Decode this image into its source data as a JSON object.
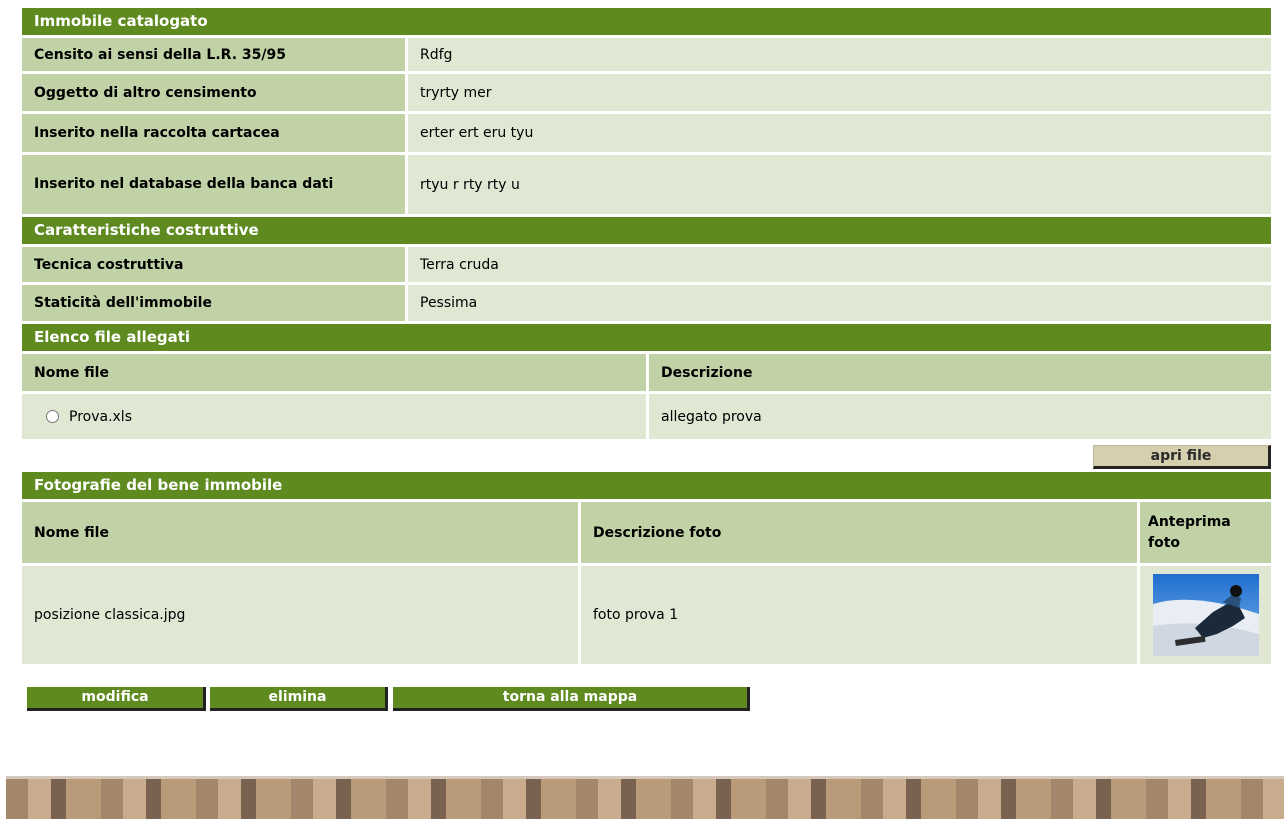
{
  "catalogato": {
    "header": "Immobile catalogato",
    "rows": [
      {
        "label": "Censito ai sensi della L.R. 35/95",
        "value": "Rdfg"
      },
      {
        "label": "Oggetto di altro censimento",
        "value": "tryrty mer"
      },
      {
        "label": "Inserito nella raccolta cartacea",
        "value": "erter ert eru tyu"
      },
      {
        "label": "Inserito nel database della banca dati",
        "value": "rtyu r rty rty u"
      }
    ]
  },
  "costruttive": {
    "header": "Caratteristiche costruttive",
    "rows": [
      {
        "label": "Tecnica costruttiva",
        "value": "Terra cruda"
      },
      {
        "label": "Staticità dell'immobile",
        "value": "Pessima"
      }
    ]
  },
  "allegati": {
    "header": "Elenco file allegati",
    "col_nome": "Nome file",
    "col_descrizione": "Descrizione",
    "file_name": "Prova.xls",
    "file_desc": "allegato prova",
    "open_button": "apri file"
  },
  "foto": {
    "header": "Fotografie del bene immobile",
    "col_nome": "Nome file",
    "col_descrizione": "Descrizione foto",
    "col_anteprima": "Anteprima foto",
    "file_name": "posizione classica.jpg",
    "file_desc": "foto prova 1"
  },
  "actions": {
    "modifica": "modifica",
    "elimina": "elimina",
    "torna": "torna alla mappa"
  },
  "colors": {
    "header_green": "#5e8a1f",
    "label_bg": "#c1d2a7",
    "value_bg": "#e0e7d2",
    "tan_button": "#d6cfae"
  }
}
